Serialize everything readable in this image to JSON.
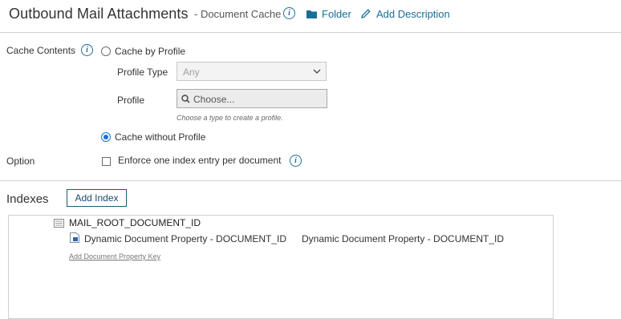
{
  "header": {
    "title": "Outbound Mail Attachments",
    "subtitle": "- Document Cache",
    "folder_label": "Folder",
    "add_description_label": "Add Description"
  },
  "cache": {
    "label": "Cache Contents",
    "by_profile_label": "Cache by Profile",
    "profile_type_label": "Profile Type",
    "profile_type_value": "Any",
    "profile_label": "Profile",
    "profile_placeholder": "Choose...",
    "hint": "Choose a type to create a profile.",
    "without_profile_label": "Cache without Profile",
    "selected": "without_profile"
  },
  "option": {
    "label": "Option",
    "enforce_label": "Enforce one index entry per document",
    "enforce_checked": false
  },
  "indexes": {
    "heading": "Indexes",
    "add_button_label": "Add Index",
    "items": [
      {
        "name": "MAIL_ROOT_DOCUMENT_ID",
        "keys": [
          {
            "property": "Dynamic Document Property - DOCUMENT_ID",
            "value": "Dynamic Document Property - DOCUMENT_ID"
          }
        ],
        "add_key_label": "Add Document Property Key"
      }
    ]
  },
  "icons": {
    "info": "info-icon",
    "folder": "folder-icon",
    "pencil": "pencil-icon",
    "search": "search-icon",
    "chevron": "chevron-down-icon",
    "index": "index-icon",
    "property": "document-property-icon"
  },
  "colors": {
    "accent": "#1a6e96",
    "radio_selected": "#1a73c9"
  }
}
